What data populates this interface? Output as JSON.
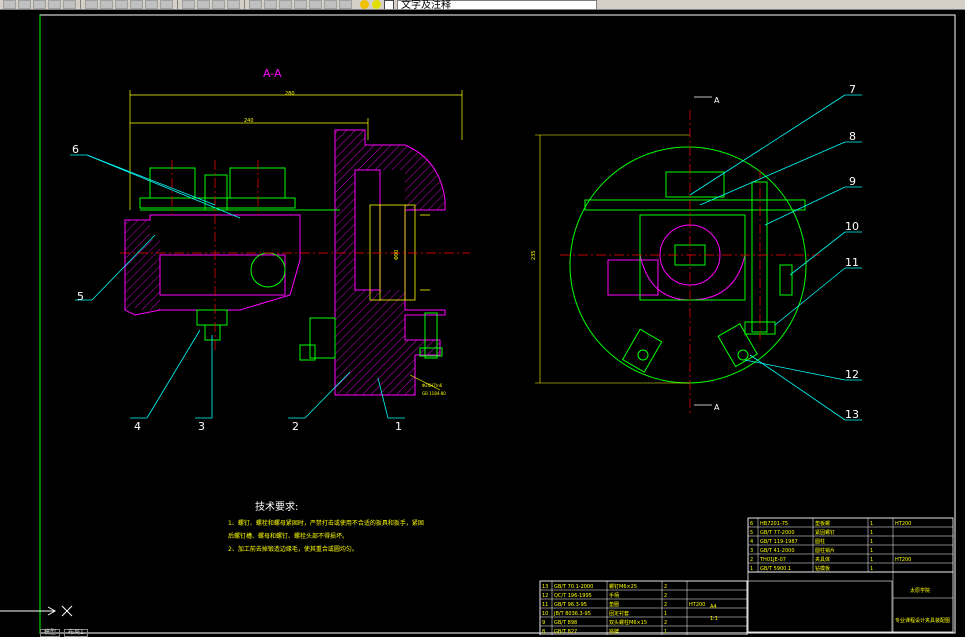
{
  "toolbar": {
    "buttons": [
      "new-icon",
      "open-icon",
      "save-icon",
      "print-icon",
      "preview-icon",
      "cut-icon",
      "copy-icon",
      "paste-icon",
      "matchprop-icon",
      "undo-icon",
      "redo-icon",
      "pan-icon",
      "zoom-icon",
      "zoom-window-icon",
      "zoom-prev-icon",
      "properties-icon",
      "design-center-icon",
      "tool-palette-icon",
      "sheet-set-icon",
      "markup-icon",
      "calculator-icon",
      "help-icon"
    ],
    "layer_name": "文字及注释"
  },
  "drawing": {
    "section_label": "A-A",
    "dim_top": "280",
    "dim_second": "240",
    "dim_left_height": "235",
    "dim_bore": "Φ90",
    "section_marks": [
      "A",
      "A"
    ],
    "leader_numbers": [
      "1",
      "2",
      "3",
      "4",
      "5",
      "6",
      "7",
      "8",
      "9",
      "10",
      "11",
      "12",
      "13"
    ],
    "note_title": "技术要求:",
    "notes": [
      "1、螺钉、螺栓和螺母紧固时，严禁打击或使用不合适的扳具和扳手，紧固",
      "后螺钉槽、螺母和螺钉、螺栓头部不得损坏。",
      "2、加工前去掉锻造边缘毛，使其重合或圆均匀。"
    ],
    "tolerance_note_1": "Φ20H7/n6",
    "tolerance_note_2": "GB 1184-80"
  },
  "parts_table_right": {
    "rows": [
      [
        "6",
        "HB7201-75",
        "垫板螺",
        "1",
        "HT200"
      ],
      [
        "5",
        "GB/T 77-2000",
        "紧固螺钉",
        "1",
        ""
      ],
      [
        "4",
        "GB/T 119-1987",
        "圆柱",
        "1",
        ""
      ],
      [
        "3",
        "GB/T 41-2000",
        "圆柱销片",
        "1",
        ""
      ],
      [
        "2",
        "TH01JE-07",
        "夹具体",
        "1",
        "HT200"
      ],
      [
        "1",
        "GB/T 5900.1",
        "钻模板",
        "1",
        ""
      ]
    ],
    "title": "专业课程设计夹具装配图",
    "org": "太原学院"
  },
  "parts_table_left": {
    "rows": [
      [
        "13",
        "GB/T 70.1-2000",
        "螺钉M6×25",
        "2",
        ""
      ],
      [
        "12",
        "QC/T 196-1995",
        "手柄",
        "2",
        ""
      ],
      [
        "11",
        "GB/T 96.3-95",
        "垫圈",
        "2",
        "HT200"
      ],
      [
        "10",
        "JB/T 8036.3-95",
        "固定衬套",
        "1",
        ""
      ],
      [
        "9",
        "GB/T 898",
        "双头螺柱M6×15",
        "2",
        ""
      ],
      [
        "8",
        "GB/T 827",
        "铭牌",
        "1",
        ""
      ]
    ],
    "a_size": "A4",
    "scale": "1:1"
  },
  "bottom_tabs": [
    "模型",
    "布局1"
  ]
}
